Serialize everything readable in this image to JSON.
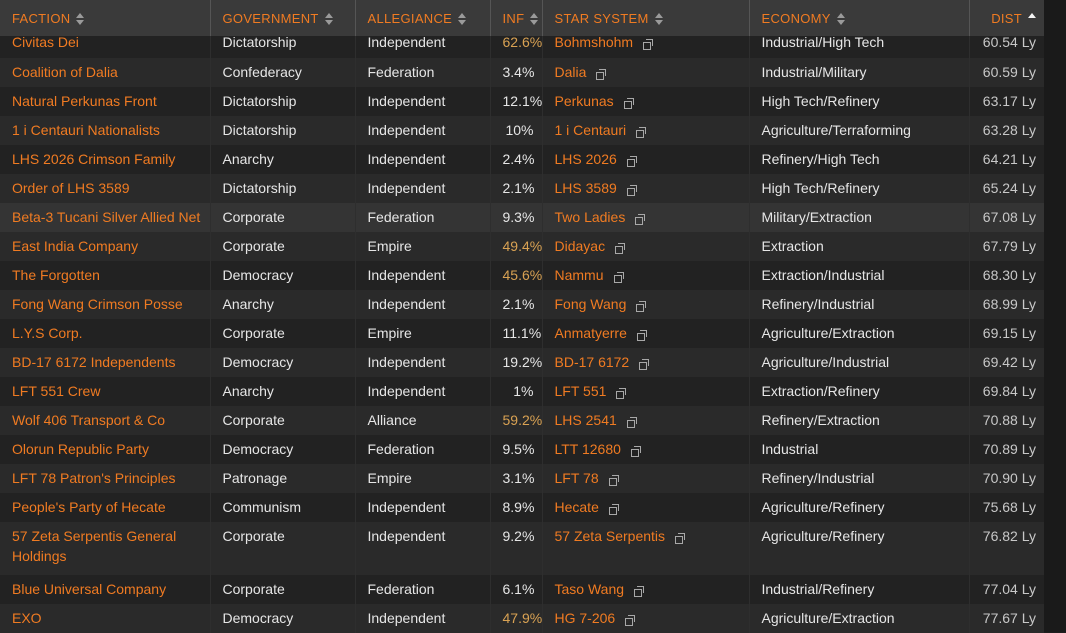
{
  "columns": [
    {
      "key": "faction",
      "label": "FACTION",
      "align": "left",
      "active": false
    },
    {
      "key": "government",
      "label": "GOVERNMENT",
      "align": "left",
      "active": false
    },
    {
      "key": "allegiance",
      "label": "ALLEGIANCE",
      "align": "left",
      "active": false
    },
    {
      "key": "inf",
      "label": "INF",
      "align": "right",
      "active": false
    },
    {
      "key": "system",
      "label": "STAR SYSTEM",
      "align": "left",
      "active": false
    },
    {
      "key": "economy",
      "label": "ECONOMY",
      "align": "left",
      "active": false
    },
    {
      "key": "dist",
      "label": "DIST",
      "align": "right",
      "active": true
    }
  ],
  "sort": {
    "column": "dist",
    "direction": "ascending"
  },
  "colors": {
    "accent": "#f07b22",
    "text": "#e6e6e6",
    "inf_high": "#d9a253",
    "header_bg": "#3a3a3a"
  },
  "icons": {
    "sort": "sort-arrows-icon",
    "external": "external-link-icon"
  },
  "rows": [
    {
      "faction": "Civitas Dei",
      "government": "Dictatorship",
      "allegiance": "Independent",
      "inf": "62.6%",
      "system": "Bohmshohm",
      "economy": "Industrial/High Tech",
      "dist": "60.54 Ly"
    },
    {
      "faction": "Coalition of Dalia",
      "government": "Confederacy",
      "allegiance": "Federation",
      "inf": "3.4%",
      "system": "Dalia",
      "economy": "Industrial/Military",
      "dist": "60.59 Ly"
    },
    {
      "faction": "Natural Perkunas Front",
      "government": "Dictatorship",
      "allegiance": "Independent",
      "inf": "12.1%",
      "system": "Perkunas",
      "economy": "High Tech/Refinery",
      "dist": "63.17 Ly"
    },
    {
      "faction": "1 i Centauri Nationalists",
      "government": "Dictatorship",
      "allegiance": "Independent",
      "inf": "10%",
      "system": "1 i Centauri",
      "economy": "Agriculture/Terraforming",
      "dist": "63.28 Ly"
    },
    {
      "faction": "LHS 2026 Crimson Family",
      "government": "Anarchy",
      "allegiance": "Independent",
      "inf": "2.4%",
      "system": "LHS 2026",
      "economy": "Refinery/High Tech",
      "dist": "64.21 Ly"
    },
    {
      "faction": "Order of LHS 3589",
      "government": "Dictatorship",
      "allegiance": "Independent",
      "inf": "2.1%",
      "system": "LHS 3589",
      "economy": "High Tech/Refinery",
      "dist": "65.24 Ly"
    },
    {
      "faction": "Beta-3 Tucani Silver Allied Net",
      "government": "Corporate",
      "allegiance": "Federation",
      "inf": "9.3%",
      "system": "Two Ladies",
      "economy": "Military/Extraction",
      "dist": "67.08 Ly"
    },
    {
      "faction": "East India Company",
      "government": "Corporate",
      "allegiance": "Empire",
      "inf": "49.4%",
      "system": "Didayac",
      "economy": "Extraction",
      "dist": "67.79 Ly"
    },
    {
      "faction": "The Forgotten",
      "government": "Democracy",
      "allegiance": "Independent",
      "inf": "45.6%",
      "system": "Nammu",
      "economy": "Extraction/Industrial",
      "dist": "68.30 Ly"
    },
    {
      "faction": "Fong Wang Crimson Posse",
      "government": "Anarchy",
      "allegiance": "Independent",
      "inf": "2.1%",
      "system": "Fong Wang",
      "economy": "Refinery/Industrial",
      "dist": "68.99 Ly"
    },
    {
      "faction": "L.Y.S Corp.",
      "government": "Corporate",
      "allegiance": "Empire",
      "inf": "11.1%",
      "system": "Anmatyerre",
      "economy": "Agriculture/Extraction",
      "dist": "69.15 Ly"
    },
    {
      "faction": "BD-17 6172 Independents",
      "government": "Democracy",
      "allegiance": "Independent",
      "inf": "19.2%",
      "system": "BD-17 6172",
      "economy": "Agriculture/Industrial",
      "dist": "69.42 Ly"
    },
    {
      "faction": "LFT 551 Crew",
      "government": "Anarchy",
      "allegiance": "Independent",
      "inf": "1%",
      "system": "LFT 551",
      "economy": "Extraction/Refinery",
      "dist": "69.84 Ly"
    },
    {
      "faction": "Wolf 406 Transport & Co",
      "government": "Corporate",
      "allegiance": "Alliance",
      "inf": "59.2%",
      "system": "LHS 2541",
      "economy": "Refinery/Extraction",
      "dist": "70.88 Ly"
    },
    {
      "faction": "Olorun Republic Party",
      "government": "Democracy",
      "allegiance": "Federation",
      "inf": "9.5%",
      "system": "LTT 12680",
      "economy": "Industrial",
      "dist": "70.89 Ly"
    },
    {
      "faction": "LFT 78 Patron's Principles",
      "government": "Patronage",
      "allegiance": "Empire",
      "inf": "3.1%",
      "system": "LFT 78",
      "economy": "Refinery/Industrial",
      "dist": "70.90 Ly"
    },
    {
      "faction": "People's Party of Hecate",
      "government": "Communism",
      "allegiance": "Independent",
      "inf": "8.9%",
      "system": "Hecate",
      "economy": "Agriculture/Refinery",
      "dist": "75.68 Ly"
    },
    {
      "faction": "57 Zeta Serpentis General Holdings",
      "government": "Corporate",
      "allegiance": "Independent",
      "inf": "9.2%",
      "system": "57 Zeta Serpentis",
      "economy": "Agriculture/Refinery",
      "dist": "76.82 Ly"
    },
    {
      "faction": "Blue Universal Company",
      "government": "Corporate",
      "allegiance": "Federation",
      "inf": "6.1%",
      "system": "Taso Wang",
      "economy": "Industrial/Refinery",
      "dist": "77.04 Ly"
    },
    {
      "faction": "EXO",
      "government": "Democracy",
      "allegiance": "Independent",
      "inf": "47.9%",
      "system": "HG 7-206",
      "economy": "Agriculture/Extraction",
      "dist": "77.67 Ly"
    }
  ]
}
